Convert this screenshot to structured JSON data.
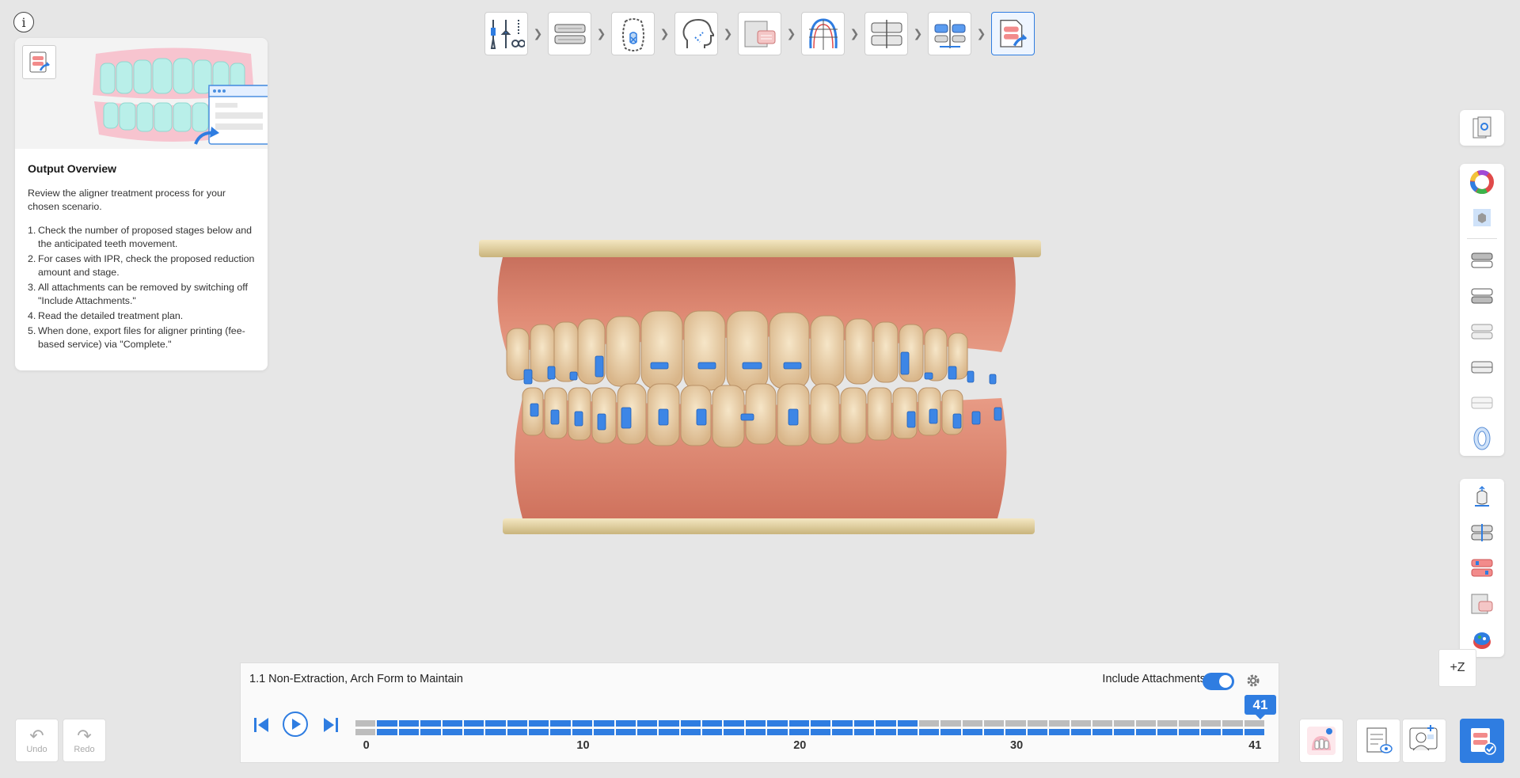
{
  "info_label": "i",
  "guide": {
    "title": "Output Overview",
    "description": "Review the aligner treatment process for your chosen scenario.",
    "items": [
      {
        "num": "1.",
        "text": "Check the number of proposed stages below and the anticipated teeth movement."
      },
      {
        "num": "2.",
        "text": "For cases with IPR, check the proposed reduction amount and stage."
      },
      {
        "num": "3.",
        "text": "All attachments can be removed by switching off \"Include Attachments.\""
      },
      {
        "num": "4.",
        "text": "Read the detailed treatment plan."
      },
      {
        "num": "5.",
        "text": "When done, export files for aligner printing (fee-based service) via \"Complete.\""
      }
    ]
  },
  "workflow_steps": [
    {
      "icon": "tools-icon",
      "active": false
    },
    {
      "icon": "arch-models-icon",
      "active": false
    },
    {
      "icon": "tooth-segmentation-icon",
      "active": false
    },
    {
      "icon": "face-profile-icon",
      "active": false
    },
    {
      "icon": "scan-align-icon",
      "active": false
    },
    {
      "icon": "arch-form-icon",
      "active": false
    },
    {
      "icon": "occlusion-icon",
      "active": false
    },
    {
      "icon": "staging-icon",
      "active": false
    },
    {
      "icon": "output-icon",
      "active": true
    }
  ],
  "timeline": {
    "scenario": "1.1 Non-Extraction, Arch Form to Maintain",
    "include_attachments_label": "Include Attachments",
    "include_attachments_on": true,
    "current_stage": "41",
    "total_stages": 41,
    "upper_active_until": 25,
    "lower_active_until": 41,
    "tick_labels": [
      "0",
      "10",
      "20",
      "30",
      "41"
    ],
    "tick_values": [
      0,
      10,
      20,
      30,
      41
    ]
  },
  "undo_label": "Undo",
  "redo_label": "Redo",
  "zoom_label": "+Z",
  "colors": {
    "accent": "#2f7de1",
    "inactive_bar": "#bdbdbd",
    "gingiva": "#d9826e",
    "teeth": "#e8cfa8",
    "attachment": "#3d86e6"
  }
}
